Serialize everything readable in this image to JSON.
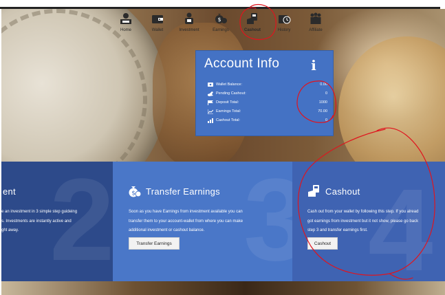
{
  "nav": {
    "items": [
      {
        "label": "Home",
        "icon": "home-icon"
      },
      {
        "label": "Wallet",
        "icon": "wallet-icon"
      },
      {
        "label": "Investment",
        "icon": "investment-icon"
      },
      {
        "label": "Earnings",
        "icon": "earnings-icon"
      },
      {
        "label": "Cashout",
        "icon": "cashout-icon",
        "active": true
      },
      {
        "label": "History",
        "icon": "history-icon"
      },
      {
        "label": "Affiliate",
        "icon": "affiliate-icon"
      }
    ]
  },
  "account_info": {
    "title": "Account Info",
    "rows": [
      {
        "label": "Wallet Balance:",
        "value": "0.00",
        "icon": "wallet-icon"
      },
      {
        "label": "Pending Cashout:",
        "value": "0",
        "icon": "hand-icon"
      },
      {
        "label": "Deposit Total:",
        "value": "1000",
        "icon": "flag-icon"
      },
      {
        "label": "Earnings Total:",
        "value": "70.00",
        "icon": "chart-line-icon"
      },
      {
        "label": "Cashout Total:",
        "value": "0",
        "icon": "bar-chart-icon"
      }
    ]
  },
  "steps": {
    "investment": {
      "title": "ent",
      "lines": [
        "e an investment in 3 simple step guideing",
        "s. Investments are instantly active and",
        "ght away."
      ],
      "big_number": "2"
    },
    "transfer": {
      "title": "Transfer Earnings",
      "lines": [
        "Soon as you have Earnings from investment available you can",
        "transfer them to your account-wallet from where you can make",
        "additional investment or cashout balance."
      ],
      "button": "Transfer Earnings",
      "big_number": "3"
    },
    "cashout": {
      "title": "Cashout",
      "lines": [
        "Cash out from your wallet by following this step. If you alread",
        "got earnings from investment but it not show, please go back",
        "step 3 and transfer earnings first."
      ],
      "button": "Cashout",
      "big_number": "4"
    }
  },
  "colors": {
    "panel_blue": "#4472c4",
    "annotation_red": "#e0141e"
  }
}
